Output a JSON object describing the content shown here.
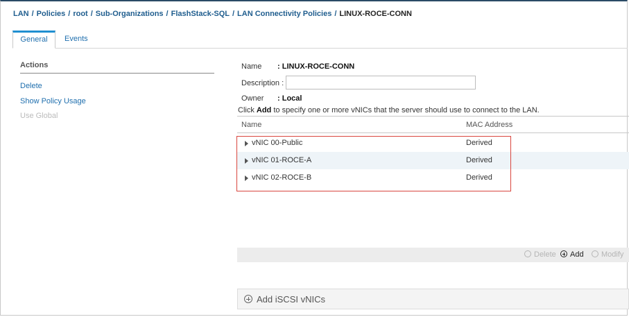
{
  "breadcrumb": {
    "items": [
      "LAN",
      "Policies",
      "root",
      "Sub-Organizations",
      "FlashStack-SQL",
      "LAN Connectivity Policies"
    ],
    "current": "LINUX-ROCE-CONN",
    "separator": "/"
  },
  "tabs": {
    "general": "General",
    "events": "Events"
  },
  "actions": {
    "title": "Actions",
    "delete": "Delete",
    "show_policy_usage": "Show Policy Usage",
    "use_global": "Use Global"
  },
  "properties": {
    "name_label": "Name",
    "name_value": ": LINUX-ROCE-CONN",
    "description_label": "Description :",
    "description_value": "",
    "owner_label": "Owner",
    "owner_value": ": Local"
  },
  "hint": {
    "prefix": "Click ",
    "bold": "Add",
    "suffix": " to specify one or more vNICs that the server should use to connect to the LAN."
  },
  "vnic_table": {
    "columns": {
      "name": "Name",
      "mac": "MAC Address"
    },
    "rows": [
      {
        "name": "vNIC 00-Public",
        "mac": "Derived"
      },
      {
        "name": "vNIC 01-ROCE-A",
        "mac": "Derived"
      },
      {
        "name": "vNIC 02-ROCE-B",
        "mac": "Derived"
      }
    ]
  },
  "toolbar": {
    "delete": "Delete",
    "add": "Add",
    "modify": "Modify"
  },
  "iscsi": {
    "label": "Add iSCSI vNICs"
  },
  "colors": {
    "link": "#1f6fae",
    "tab_accent": "#1f8fd1",
    "highlight_border": "#d9453d",
    "alt_row": "#eef4f8"
  }
}
